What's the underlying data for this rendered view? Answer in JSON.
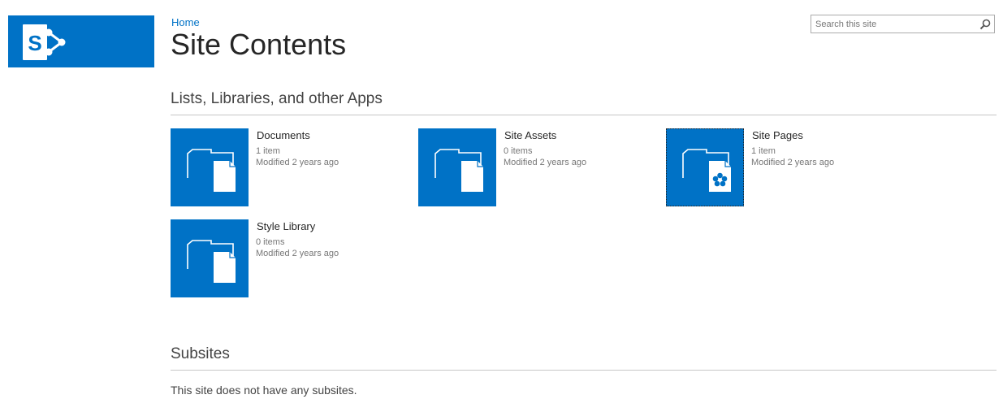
{
  "header": {
    "breadcrumb": "Home",
    "title": "Site Contents",
    "logo_icon": "sharepoint-logo-icon",
    "brand_color": "#0072c6"
  },
  "search": {
    "placeholder": "Search this site",
    "value": "",
    "icon": "search-icon"
  },
  "apps_section": {
    "heading": "Lists, Libraries, and other Apps",
    "tiles": [
      {
        "name": "Documents",
        "count": "1 item",
        "modified": "Modified 2 years ago",
        "icon": "document-library-icon"
      },
      {
        "name": "Site Assets",
        "count": "0 items",
        "modified": "Modified 2 years ago",
        "icon": "document-library-icon"
      },
      {
        "name": "Site Pages",
        "count": "1 item",
        "modified": "Modified 2 years ago",
        "icon": "wiki-page-library-icon",
        "selected": true
      },
      {
        "name": "Style Library",
        "count": "0 items",
        "modified": "Modified 2 years ago",
        "icon": "document-library-icon"
      }
    ]
  },
  "subsites_section": {
    "heading": "Subsites",
    "message": "This site does not have any subsites."
  }
}
